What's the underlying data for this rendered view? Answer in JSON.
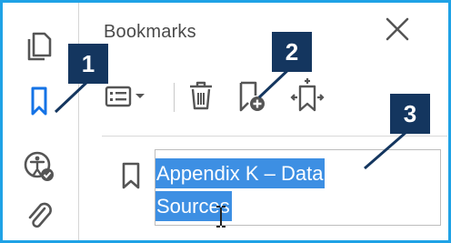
{
  "panel": {
    "title": "Bookmarks"
  },
  "bookmark": {
    "line1": "Appendix K – Data",
    "line2": "Sources"
  },
  "callouts": [
    "1",
    "2",
    "3"
  ],
  "icons": {
    "rail": [
      "pages-icon",
      "bookmarks-icon",
      "accessibility-check-icon",
      "attachments-icon"
    ],
    "toolbar": [
      "options-menu-icon",
      "delete-icon",
      "new-bookmark-icon",
      "expand-bookmark-icon"
    ]
  },
  "colors": {
    "frame": "#1fa2e6",
    "accent": "#1473e6",
    "callout": "#14365f",
    "selection": "#3d8fe3"
  }
}
